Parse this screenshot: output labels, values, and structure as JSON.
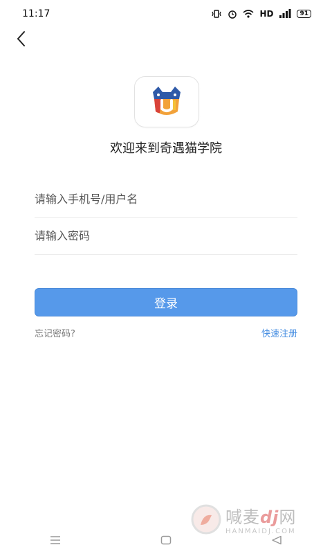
{
  "status_bar": {
    "time": "11:17",
    "network": "HD",
    "battery": "91"
  },
  "header": {
    "back_icon": "chevron-left-icon"
  },
  "app": {
    "logo_icon": "cat-logo-icon",
    "welcome": "欢迎来到奇遇猫学院"
  },
  "form": {
    "phone_placeholder": "请输入手机号/用户名",
    "phone_value": "",
    "password_placeholder": "请输入密码",
    "password_value": "",
    "login_label": "登录",
    "forgot_label": "忘记密码?",
    "register_label": "快速注册"
  },
  "colors": {
    "accent": "#5699ea",
    "link": "#4a90e2"
  },
  "watermark": {
    "main_prefix": "喊麦",
    "main_dj": "dj",
    "main_suffix": "网",
    "sub": "HANMAIDJ.COM"
  },
  "nav_bar": {
    "icons": [
      "menu-icon",
      "home-square-icon",
      "back-triangle-icon"
    ]
  }
}
